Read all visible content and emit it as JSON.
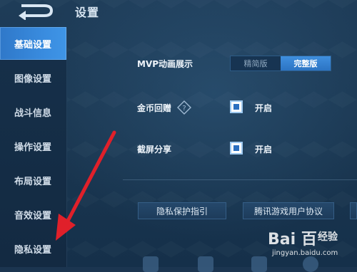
{
  "header": {
    "title": "设置"
  },
  "sidebar": {
    "items": [
      {
        "label": "基础设置",
        "active": true
      },
      {
        "label": "图像设置",
        "active": false
      },
      {
        "label": "战斗信息",
        "active": false
      },
      {
        "label": "操作设置",
        "active": false
      },
      {
        "label": "布局设置",
        "active": false
      },
      {
        "label": "音效设置",
        "active": false
      },
      {
        "label": "隐私设置",
        "active": false
      }
    ]
  },
  "settings": {
    "mvp": {
      "label": "MVP动画展示",
      "options": [
        "精简版",
        "完整版"
      ],
      "selected": "完整版"
    },
    "coin_gift": {
      "label": "金币回赠",
      "help_icon": "question-diamond-icon",
      "checkbox_label": "开启",
      "checked": true
    },
    "screenshot_share": {
      "label": "截屏分享",
      "checkbox_label": "开启",
      "checked": true
    }
  },
  "links": {
    "privacy_guide": "隐私保护指引",
    "user_agreement": "腾讯游戏用户协议"
  },
  "watermark": {
    "brand": "Bai 百",
    "sub": "经验",
    "url": "jingyan.baidu.com"
  },
  "colors": {
    "accent": "#3a8de0",
    "background": "#1b3550",
    "arrow": "#e0202a"
  }
}
